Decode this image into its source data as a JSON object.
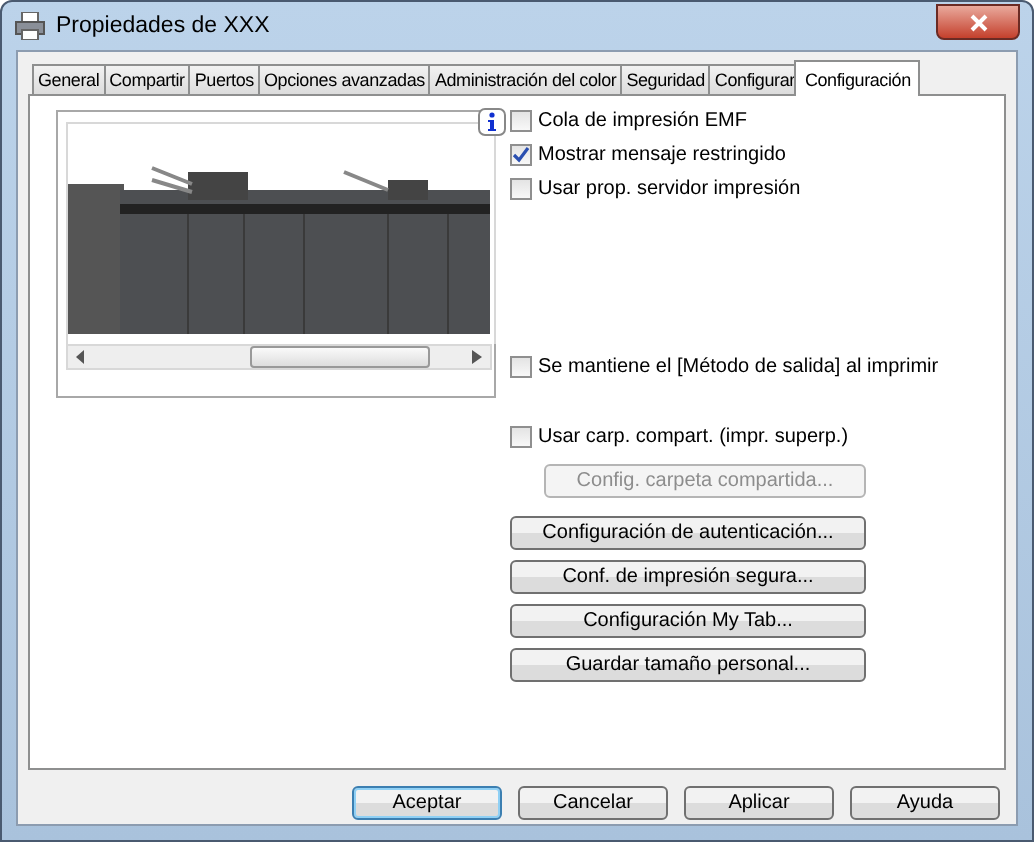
{
  "window": {
    "title": "Propiedades de XXX"
  },
  "tabs": [
    {
      "label": "General",
      "selected": false
    },
    {
      "label": "Compartir",
      "selected": false
    },
    {
      "label": "Puertos",
      "selected": false
    },
    {
      "label": "Opciones avanzadas",
      "selected": false
    },
    {
      "label": "Administración del color",
      "selected": false
    },
    {
      "label": "Seguridad",
      "selected": false
    },
    {
      "label": "Configurar",
      "selected": false
    },
    {
      "label": "Configuración",
      "selected": true
    }
  ],
  "sections": [
    {
      "items": [
        {
          "kind": "checkbox",
          "label": "Cola de impresión EMF",
          "checked": false
        },
        {
          "kind": "checkbox",
          "label": "Mostrar mensaje restringido",
          "checked": true
        },
        {
          "kind": "checkbox",
          "label": "Usar prop. servidor impresión",
          "checked": false
        }
      ]
    },
    {
      "items": [
        {
          "kind": "checkbox",
          "label": "Se mantiene el [Método de salida] al imprimir",
          "checked": false
        }
      ]
    },
    {
      "items": [
        {
          "kind": "checkbox",
          "label": "Usar carp. compart. (impr. superp.)",
          "checked": false
        },
        {
          "kind": "button",
          "label": "Config. carpeta compartida...",
          "disabled": true
        }
      ]
    },
    {
      "items": [
        {
          "kind": "button",
          "label": "Configuración de autenticación...",
          "disabled": false
        },
        {
          "kind": "button",
          "label": "Conf. de impresión segura...",
          "disabled": false
        },
        {
          "kind": "button",
          "label": "Configuración My Tab...",
          "disabled": false
        },
        {
          "kind": "button",
          "label": "Guardar tamaño personal...",
          "disabled": false
        }
      ]
    }
  ],
  "buttons": [
    {
      "label": "Aceptar",
      "default": true
    },
    {
      "label": "Cancelar",
      "default": false
    },
    {
      "label": "Aplicar",
      "default": false
    },
    {
      "label": "Ayuda",
      "default": false
    }
  ]
}
